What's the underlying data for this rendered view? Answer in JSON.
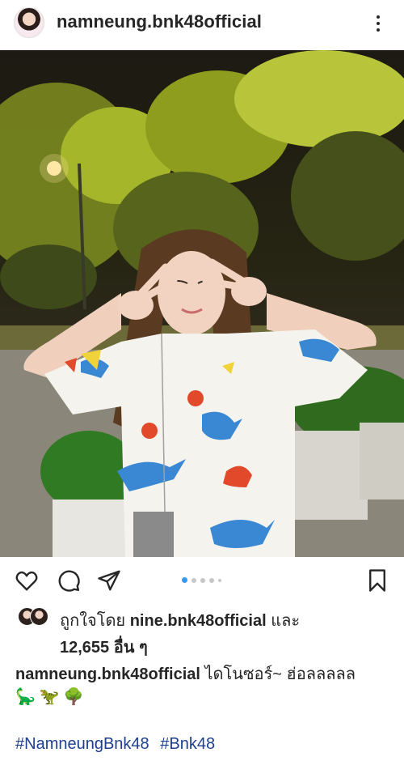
{
  "post": {
    "username": "namneung.bnk48official",
    "more_icon": "more-vertical-icon"
  },
  "photo": {
    "description_icon": "photo"
  },
  "actions": {
    "like_icon": "heart-icon",
    "comment_icon": "comment-icon",
    "share_icon": "send-icon",
    "save_icon": "bookmark-icon",
    "carousel_total": 5,
    "carousel_index": 1
  },
  "likes": {
    "prefix": "ถูกใจโดย",
    "liked_by": "nine.bnk48official",
    "and": "และ",
    "count": "12,655 อื่น ๆ"
  },
  "caption": {
    "username": "namneung.bnk48official",
    "text": "ไดโนซอร์~ ฮ่อลลลลล",
    "emojis": "🦕🦖🌳"
  },
  "hashtags": [
    "#NamneungBnk48",
    "#Bnk48"
  ],
  "colors": {
    "accent": "#3897f0",
    "hashtag": "#1e3f8f",
    "text": "#262626"
  }
}
